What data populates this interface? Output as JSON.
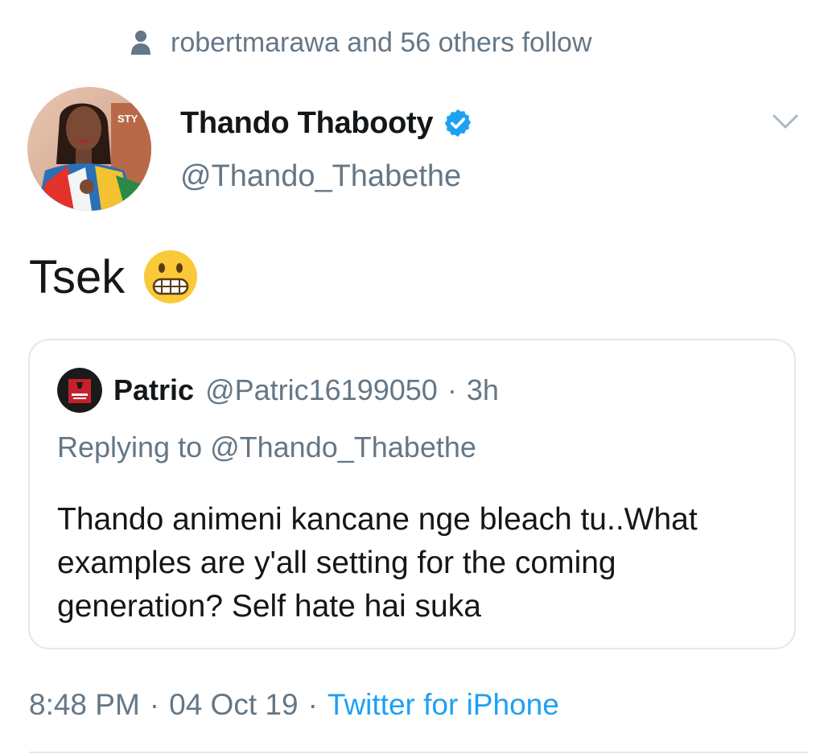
{
  "social_context": {
    "icon": "person-icon",
    "text": "robertmarawa and 56 others follow"
  },
  "tweet": {
    "author": {
      "display_name": "Thando Thabooty",
      "handle": "@Thando_Thabethe",
      "verified": true,
      "verified_icon": "verified-badge-icon"
    },
    "menu_icon": "chevron-down-icon",
    "text": "Tsek",
    "emoji_icon": "grimacing-face-icon",
    "timestamp": {
      "time": "8:48 PM",
      "separator1": "·",
      "date": "04 Oct 19",
      "separator2": "·",
      "source": "Twitter for iPhone"
    }
  },
  "quoted_tweet": {
    "name": "Patric",
    "handle": "@Patric16199050",
    "separator": "·",
    "age": "3h",
    "replying_to": "Replying to @Thando_Thabethe",
    "text": "Thando animeni kancane nge bleach tu..What examples are y'all setting for the coming generation? Self hate hai suka"
  },
  "colors": {
    "text_primary": "#14171a",
    "text_secondary": "#657786",
    "link": "#1da1f2",
    "verified": "#1da1f2",
    "border": "#e1e8ed"
  }
}
